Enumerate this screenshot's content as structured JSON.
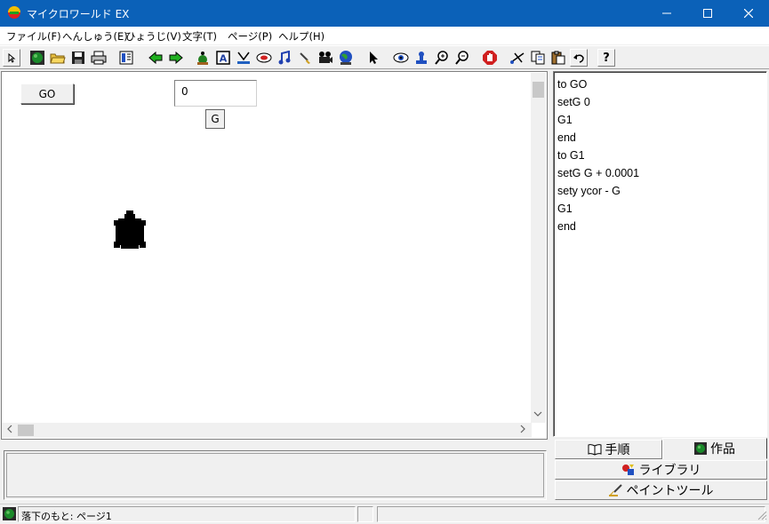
{
  "window": {
    "title": "マイクロワールド EX",
    "minimize_icon": "minimize-icon",
    "maximize_icon": "maximize-icon",
    "close_icon": "close-icon"
  },
  "menu": [
    {
      "label": "ファイル(F)"
    },
    {
      "label": "へんしゅう(E)"
    },
    {
      "label": "ひょうじ(V)"
    },
    {
      "label": "文字(T)"
    },
    {
      "label": "ページ(P)"
    },
    {
      "label": "ヘルプ(H)"
    }
  ],
  "toolbar": {
    "icons": [
      "cursor-small-icon",
      "globe-icon",
      "open-folder-icon",
      "save-icon",
      "print-icon",
      "layout-icon",
      "back-arrow-icon",
      "forward-arrow-icon",
      "turtle-hatch-icon",
      "text-box-icon",
      "slider-icon",
      "button-tool-icon",
      "music-icon",
      "paintbrush-icon",
      "video-icon",
      "globe-blue-icon",
      "pointer-icon",
      "eye-icon",
      "stamp-icon",
      "zoom-in-icon",
      "zoom-out-icon",
      "stop-icon",
      "scissors-icon",
      "copy-icon",
      "paste-icon",
      "undo-icon",
      "help-icon"
    ],
    "help_label": "?"
  },
  "canvas": {
    "go_button": "GO",
    "value_box": "0",
    "g_button": "G"
  },
  "code": [
    "to GO",
    "setG 0",
    "G1",
    "end",
    "to G1",
    "setG G + 0.0001",
    "sety ycor - G",
    "G1",
    "end"
  ],
  "tabs": {
    "steps": "手順",
    "works": "作品",
    "library": "ライブラリ",
    "paint": "ペイントツール"
  },
  "status": {
    "text": "落下のもと: ページ1"
  },
  "colors": {
    "titlebar": "#0b61b8",
    "window_bg": "#f0f0f0"
  }
}
